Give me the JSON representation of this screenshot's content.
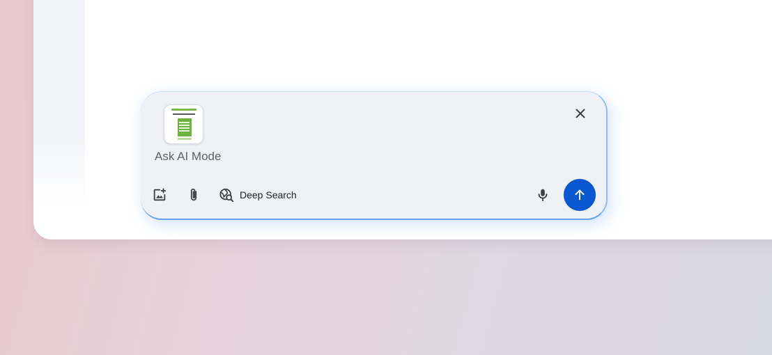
{
  "composer": {
    "prompt_text": "Ask AI Mode",
    "attachment_icon": "document-thumbnail",
    "close_icon": "close-icon",
    "tools": {
      "image_icon": "add-image-icon",
      "attach_icon": "paperclip-icon",
      "deep_search_icon": "globe-search-icon",
      "deep_search_label": "Deep Search",
      "mic_icon": "mic-icon",
      "send_icon": "arrow-up-icon"
    },
    "colors": {
      "send_button": "#0b57d0",
      "focus_border": "#5ea2ee",
      "composer_bg": "#eff1f4"
    }
  }
}
